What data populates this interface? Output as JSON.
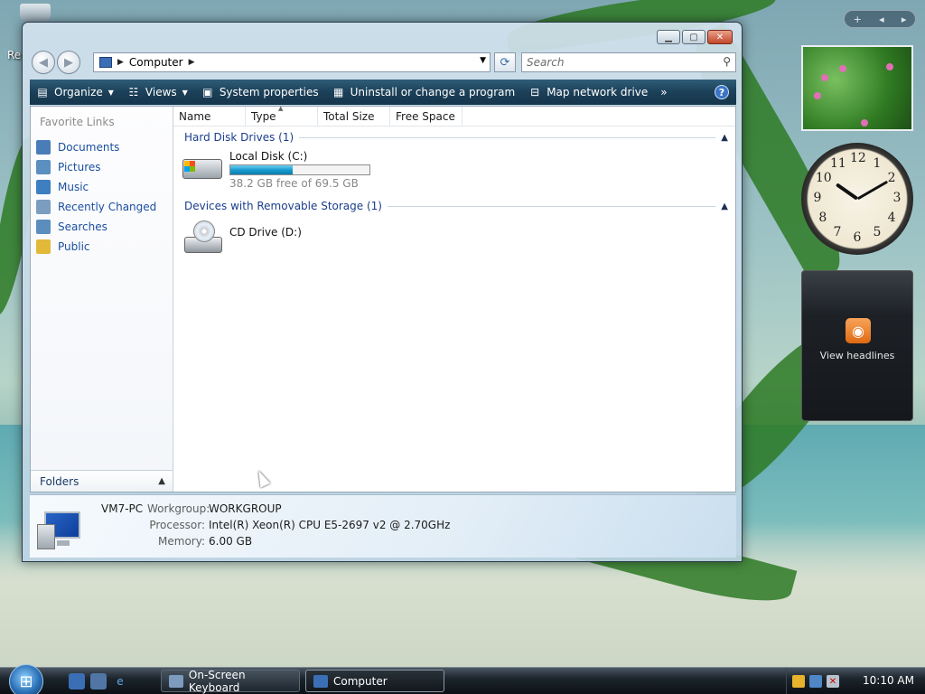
{
  "desktop": {
    "label_partial": "Re"
  },
  "window": {
    "address": {
      "location": "Computer"
    },
    "search": {
      "placeholder": "Search"
    },
    "toolbar": {
      "organize": "Organize",
      "views": "Views",
      "system_properties": "System properties",
      "uninstall": "Uninstall or change a program",
      "map_network_drive": "Map network drive",
      "more": "»",
      "help": "?"
    },
    "nav": {
      "favorite_links_title": "Favorite Links",
      "items": [
        {
          "label": "Documents",
          "color": "#4a7db8"
        },
        {
          "label": "Pictures",
          "color": "#5a8fbf"
        },
        {
          "label": "Music",
          "color": "#3d7fc1"
        },
        {
          "label": "Recently Changed",
          "color": "#7a9dc0"
        },
        {
          "label": "Searches",
          "color": "#5b8dbd"
        },
        {
          "label": "Public",
          "color": "#e3b93a"
        }
      ],
      "folders_label": "Folders"
    },
    "columns": [
      "Name",
      "Type",
      "Total Size",
      "Free Space"
    ],
    "groups": [
      {
        "title": "Hard Disk Drives (1)",
        "drives": [
          {
            "name": "Local Disk (C:)",
            "free_text": "38.2 GB free of 69.5 GB",
            "used_fraction": 0.45
          }
        ]
      },
      {
        "title": "Devices with Removable Storage (1)",
        "drives": [
          {
            "name": "CD Drive (D:)"
          }
        ]
      }
    ],
    "details": {
      "computer_name": "VM7-PC",
      "workgroup_label": "Workgroup:",
      "workgroup_value": "WORKGROUP",
      "processor_label": "Processor:",
      "processor_value": "Intel(R) Xeon(R) CPU E5-2697 v2 @ 2.70GHz",
      "memory_label": "Memory:",
      "memory_value": "6.00 GB"
    }
  },
  "sidebar": {
    "controls": {
      "add": "+",
      "prev": "◂",
      "next": "▸"
    },
    "clock": {
      "numbers": [
        "12",
        "1",
        "2",
        "3",
        "4",
        "5",
        "6",
        "7",
        "8",
        "9",
        "10",
        "11"
      ],
      "hour": 10,
      "minute": 10
    },
    "rss": {
      "label": "View headlines"
    }
  },
  "taskbar": {
    "tasks": [
      {
        "label": "On-Screen Keyboard",
        "active": false
      },
      {
        "label": "Computer",
        "active": true
      }
    ],
    "time": "10:10 AM"
  }
}
